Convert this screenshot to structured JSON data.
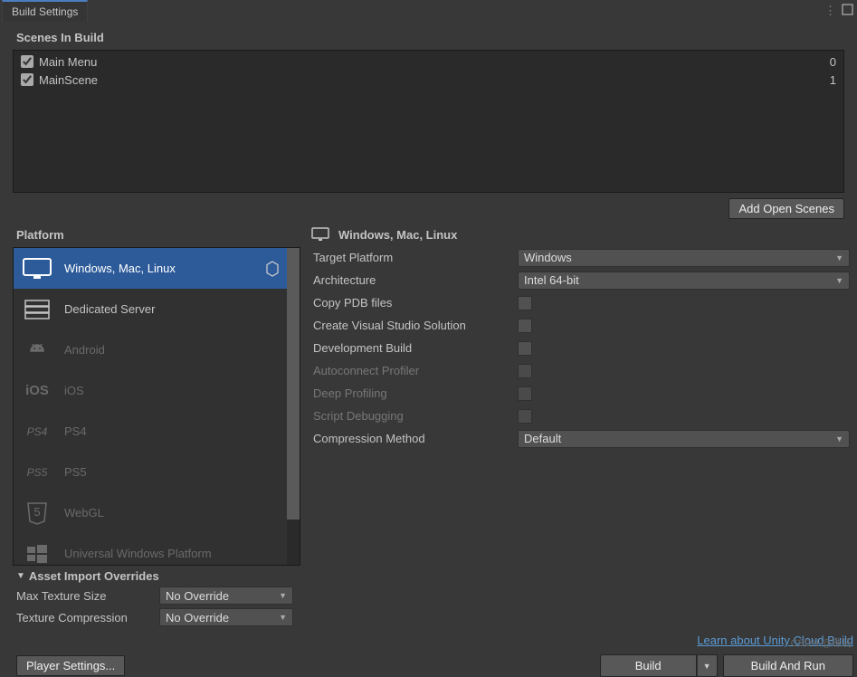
{
  "window": {
    "title": "Build Settings"
  },
  "scenes": {
    "header": "Scenes In Build",
    "items": [
      {
        "label": "Main Menu",
        "index": "0",
        "checked": true
      },
      {
        "label": "MainScene",
        "index": "1",
        "checked": true
      }
    ],
    "add_button": "Add Open Scenes"
  },
  "platform": {
    "header": "Platform",
    "items": [
      {
        "label": "Windows, Mac, Linux",
        "selected": true,
        "enabled": true,
        "icon": "monitor-icon",
        "badge": true
      },
      {
        "label": "Dedicated Server",
        "selected": false,
        "enabled": true,
        "icon": "server-icon"
      },
      {
        "label": "Android",
        "selected": false,
        "enabled": false,
        "icon": "android-icon"
      },
      {
        "label": "iOS",
        "selected": false,
        "enabled": false,
        "icon": "ios-icon"
      },
      {
        "label": "PS4",
        "selected": false,
        "enabled": false,
        "icon": "ps4-icon"
      },
      {
        "label": "PS5",
        "selected": false,
        "enabled": false,
        "icon": "ps5-icon"
      },
      {
        "label": "WebGL",
        "selected": false,
        "enabled": false,
        "icon": "webgl-icon"
      },
      {
        "label": "Universal Windows Platform",
        "selected": false,
        "enabled": false,
        "icon": "uwp-icon"
      }
    ]
  },
  "settings": {
    "header": "Windows, Mac, Linux",
    "target_platform": {
      "label": "Target Platform",
      "value": "Windows"
    },
    "architecture": {
      "label": "Architecture",
      "value": "Intel 64-bit"
    },
    "copy_pdb": {
      "label": "Copy PDB files"
    },
    "vs_sln": {
      "label": "Create Visual Studio Solution"
    },
    "dev_build": {
      "label": "Development Build"
    },
    "autoconnect": {
      "label": "Autoconnect Profiler"
    },
    "deep_profiling": {
      "label": "Deep Profiling"
    },
    "script_debug": {
      "label": "Script Debugging"
    },
    "compression": {
      "label": "Compression Method",
      "value": "Default"
    }
  },
  "overrides": {
    "header": "Asset Import Overrides",
    "max_texture": {
      "label": "Max Texture Size",
      "value": "No Override"
    },
    "texture_compression": {
      "label": "Texture Compression",
      "value": "No Override"
    }
  },
  "learn_link": "Learn about Unity Cloud Build",
  "bottom": {
    "player_settings": "Player Settings...",
    "build": "Build",
    "build_and_run": "Build And Run"
  },
  "watermark": "CSDN @珠玩"
}
